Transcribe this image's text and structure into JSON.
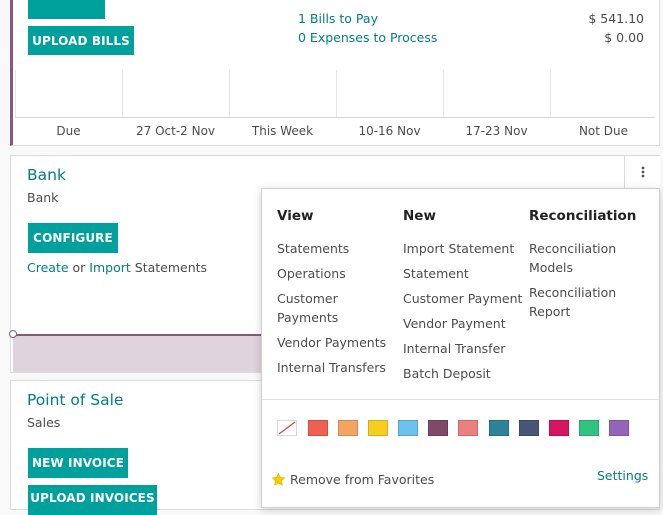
{
  "purchase": {
    "upload_bills_label": "UPLOAD BILLS",
    "bills_to_pay_label": "1 Bills to Pay",
    "bills_to_pay_amount": "$ 541.10",
    "expenses_label": "0 Expenses to Process",
    "expenses_amount": "$ 0.00",
    "axis_labels": [
      "Due",
      "27 Oct-2 Nov",
      "This Week",
      "10-16 Nov",
      "17-23 Nov",
      "Not Due"
    ]
  },
  "bank": {
    "title": "Bank",
    "subtitle": "Bank",
    "configure_label": "CONFIGURE",
    "create_link": "Create",
    "or_text": " or ",
    "import_link": "Import",
    "statements_text": " Statements"
  },
  "pos": {
    "title": "Point of Sale",
    "subtitle": "Sales",
    "new_invoice_label": "NEW INVOICE",
    "upload_invoices_label": "UPLOAD INVOICES"
  },
  "dropdown": {
    "menu_icon": "vertical-ellipsis-icon",
    "view": {
      "heading": "View",
      "items": [
        "Statements",
        "Operations",
        "Customer\nPayments",
        "Vendor Payments",
        "Internal Transfers"
      ]
    },
    "new": {
      "heading": "New",
      "items": [
        "Import Statement",
        "Statement",
        "Customer Payment",
        "Vendor Payment",
        "Internal Transfer",
        "Batch Deposit"
      ]
    },
    "reconciliation": {
      "heading": "Reconciliation",
      "items": [
        "Reconciliation\nModels",
        "Reconciliation\nReport"
      ]
    },
    "colors": [
      "#ffffff",
      "#f06050",
      "#f4a460",
      "#f7cd1f",
      "#6cc1ed",
      "#814968",
      "#eb7e7f",
      "#2c8397",
      "#475577",
      "#d6145f",
      "#30c381",
      "#9365b8"
    ],
    "favorite_icon": "star-icon",
    "remove_favorites_label": "Remove from Favorites",
    "settings_label": "Settings"
  }
}
